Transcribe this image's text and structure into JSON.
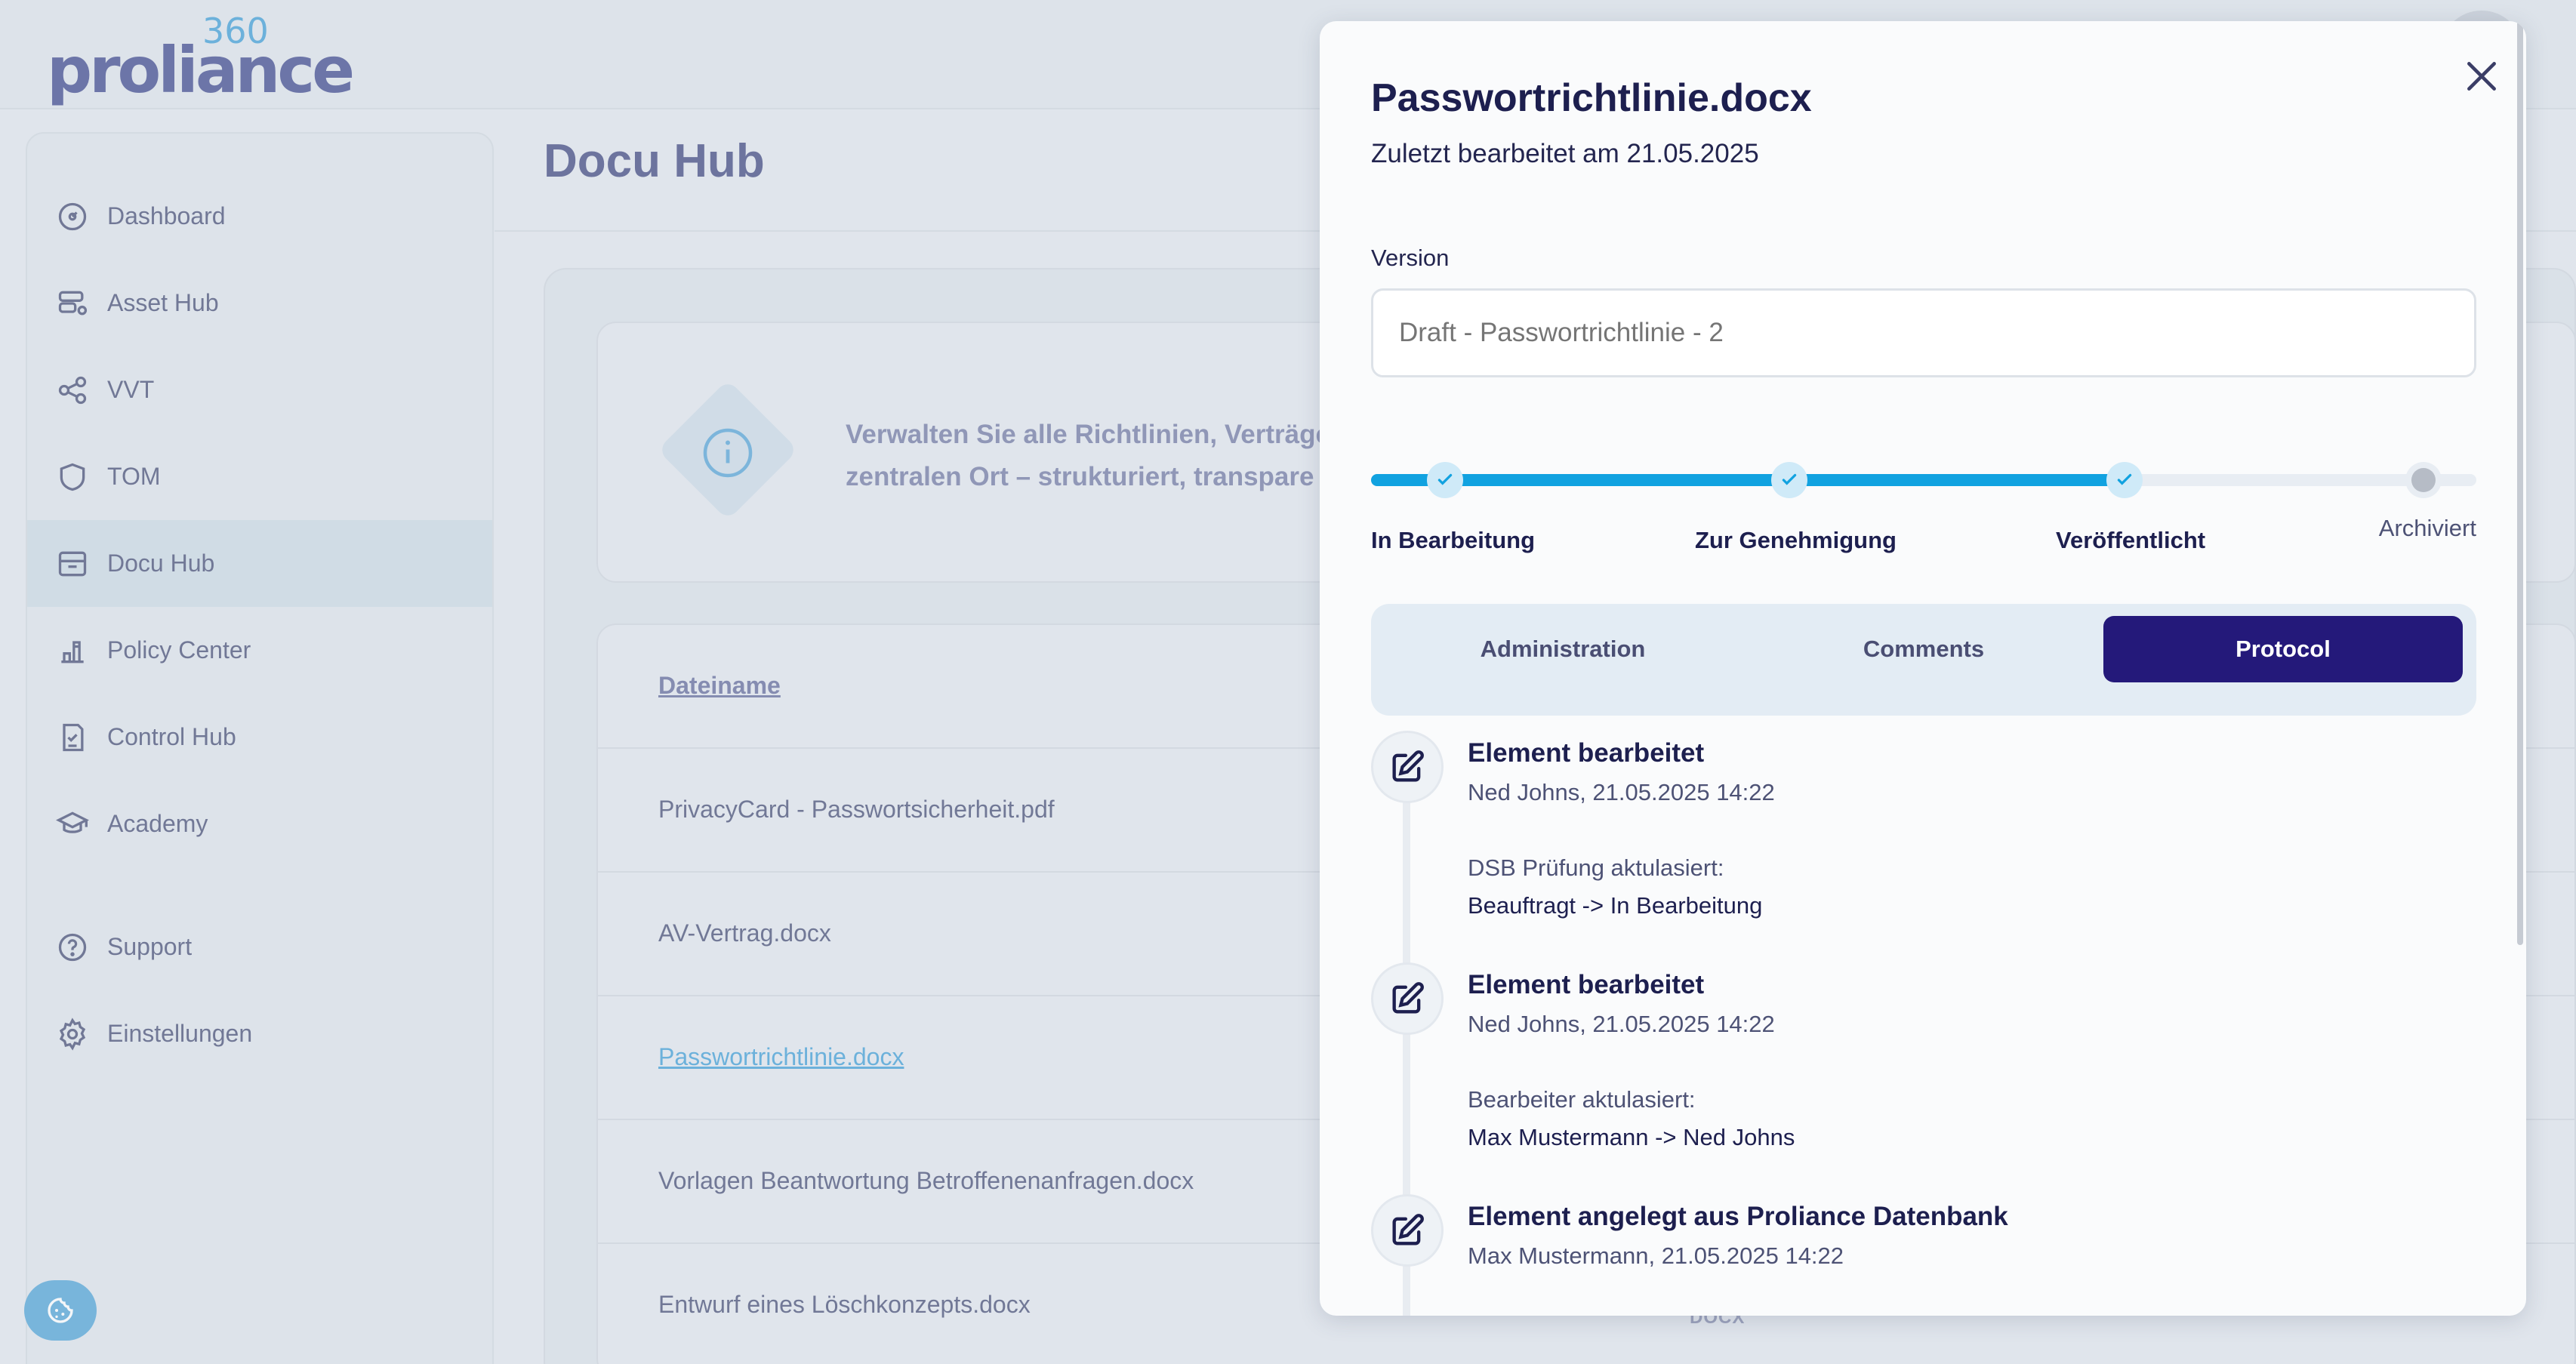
{
  "app": {
    "logo_word": "proliance",
    "logo_number": "360"
  },
  "sidebar": {
    "items": [
      {
        "label": "Dashboard",
        "icon": "gauge-icon"
      },
      {
        "label": "Asset Hub",
        "icon": "server-gear-icon"
      },
      {
        "label": "VVT",
        "icon": "share-nodes-icon"
      },
      {
        "label": "TOM",
        "icon": "shield-icon"
      },
      {
        "label": "Docu Hub",
        "icon": "archive-box-icon",
        "active": true
      },
      {
        "label": "Policy Center",
        "icon": "policy-icon"
      },
      {
        "label": "Control Hub",
        "icon": "checklist-icon"
      },
      {
        "label": "Academy",
        "icon": "graduation-cap-icon"
      }
    ],
    "bottom_items": [
      {
        "label": "Support",
        "icon": "help-circle-icon"
      },
      {
        "label": "Einstellungen",
        "icon": "gear-icon"
      }
    ]
  },
  "main": {
    "page_title": "Docu Hub",
    "info_line1": "Verwalten Sie alle Richtlinien, Verträge",
    "info_line2": "zentralen Ort – strukturiert, transpare",
    "table_header": "Dateiname",
    "rows": [
      "PrivacyCard - Passwortsicherheit.pdf",
      "AV-Vertrag.docx",
      "Passwortrichtlinie.docx",
      "Vorlagen Beantwortung Betroffenenanfragen.docx",
      "Entwurf eines Löschkonzepts.docx"
    ],
    "type_badge": "DOCX"
  },
  "drawer": {
    "title": "Passwortrichtlinie.docx",
    "subtitle": "Zuletzt bearbeitet am 21.05.2025",
    "version_label": "Version",
    "version_placeholder": "Draft - Passwortrichtlinie - 2",
    "steps": [
      {
        "label": "In Bearbeitung",
        "done": true
      },
      {
        "label": "Zur Genehmigung",
        "done": true
      },
      {
        "label": "Veröffentlicht",
        "done": true
      },
      {
        "label": "Archiviert",
        "done": false
      }
    ],
    "progress_fraction": 0.68,
    "tabs": [
      {
        "label": "Administration",
        "active": false
      },
      {
        "label": "Comments",
        "active": false
      },
      {
        "label": "Protocol",
        "active": true
      }
    ],
    "protocol": [
      {
        "title": "Element bearbeitet",
        "meta": "Ned Johns, 21.05.2025 14:22",
        "change_label": "DSB Prüfung aktulasiert:",
        "change_value": "Beauftragt -> In Bearbeitung"
      },
      {
        "title": "Element bearbeitet",
        "meta": "Ned Johns, 21.05.2025 14:22",
        "change_label": "Bearbeiter aktulasiert:",
        "change_value": "Max Mustermann -> Ned Johns"
      },
      {
        "title": "Element angelegt aus Proliance Datenbank",
        "meta": "Max Mustermann, 21.05.2025 14:22"
      }
    ]
  },
  "colors": {
    "accent": "#11a2e0",
    "tab_active": "#24197a",
    "brand": "#4a5394"
  }
}
